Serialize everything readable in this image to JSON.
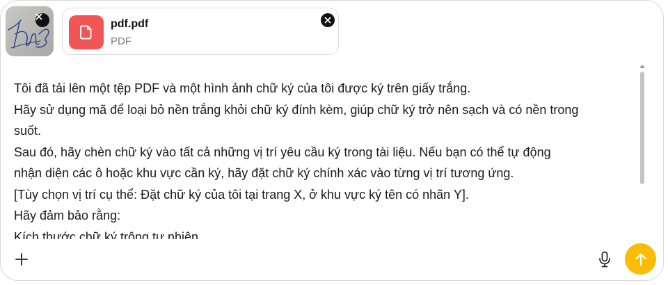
{
  "attachments": {
    "image": {
      "icon": "signature-image-thumbnail",
      "remove_icon": "close-icon"
    },
    "file": {
      "name": "pdf.pdf",
      "type": "PDF",
      "icon": "document-icon",
      "icon_color": "#f25555",
      "remove_icon": "close-icon"
    }
  },
  "message": {
    "lines": [
      "Tôi đã tải lên một tệp PDF và một hình ảnh chữ ký của tôi được ký trên giấy trắng.",
      "Hãy sử dụng mã để loại bỏ nền trắng khỏi chữ ký đính kèm, giúp chữ ký trở nên sạch và có nền trong",
      "suốt.",
      "Sau đó, hãy chèn chữ ký vào tất cả những vị trí yêu cầu ký trong tài liệu. Nếu bạn có thể tự động",
      "nhận diện các ô hoặc khu vực cần ký, hãy đặt chữ ký chính xác vào từng vị trí tương ứng.",
      "[Tùy chọn vị trí cụ thể: Đặt chữ ký của tôi tại trang X, ở khu vực ký tên có nhãn Y].",
      "Hãy đảm bảo rằng:",
      "Kích thước chữ ký trông tự nhiên."
    ]
  },
  "toolbar": {
    "add_icon": "plus-icon",
    "mic_icon": "microphone-icon",
    "send_icon": "arrow-up-icon",
    "send_color": "#fbbc05"
  }
}
